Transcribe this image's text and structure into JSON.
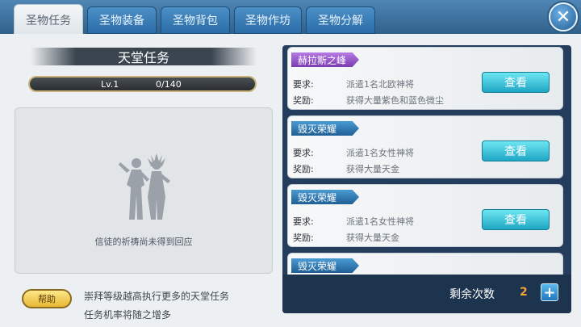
{
  "tabs": [
    {
      "label": "圣物任务",
      "active": true
    },
    {
      "label": "圣物装备",
      "active": false
    },
    {
      "label": "圣物背包",
      "active": false
    },
    {
      "label": "圣物作坊",
      "active": false
    },
    {
      "label": "圣物分解",
      "active": false
    }
  ],
  "close_icon": "✕",
  "title": "天堂任务",
  "level": {
    "label": "Lv.1",
    "progress_text": "0/140",
    "progress_fraction": 0.0
  },
  "prayer": {
    "message": "信徒的祈祷尚未得到回应",
    "figure_icon": "statue-silhouette-icon"
  },
  "help": {
    "label": "帮助"
  },
  "info": {
    "line1": "崇拜等级越高执行更多的天堂任务",
    "line2": "任务机率将随之增多"
  },
  "tasks": [
    {
      "name": "赫拉斯之峰",
      "tag_color": "#9b5bd0",
      "req_label": "要求:",
      "req_value": "派遣1名北欧神将",
      "reward_label": "奖励:",
      "reward_value": "获得大量紫色和蓝色微尘",
      "button": "查看"
    },
    {
      "name": "毁灭荣耀",
      "tag_color": "#2a78b4",
      "req_label": "要求:",
      "req_value": "派遣1名女性神将",
      "reward_label": "奖励:",
      "reward_value": "获得大量天金",
      "button": "查看"
    },
    {
      "name": "毁灭荣耀",
      "tag_color": "#2a78b4",
      "req_label": "要求:",
      "req_value": "派遣1名女性神将",
      "reward_label": "奖励:",
      "reward_value": "获得大量天金",
      "button": "查看"
    },
    {
      "name": "毁灭荣耀",
      "tag_color": "#2a78b4"
    }
  ],
  "remaining": {
    "label": "剩余次数",
    "count": "2",
    "plus_icon": "+"
  }
}
